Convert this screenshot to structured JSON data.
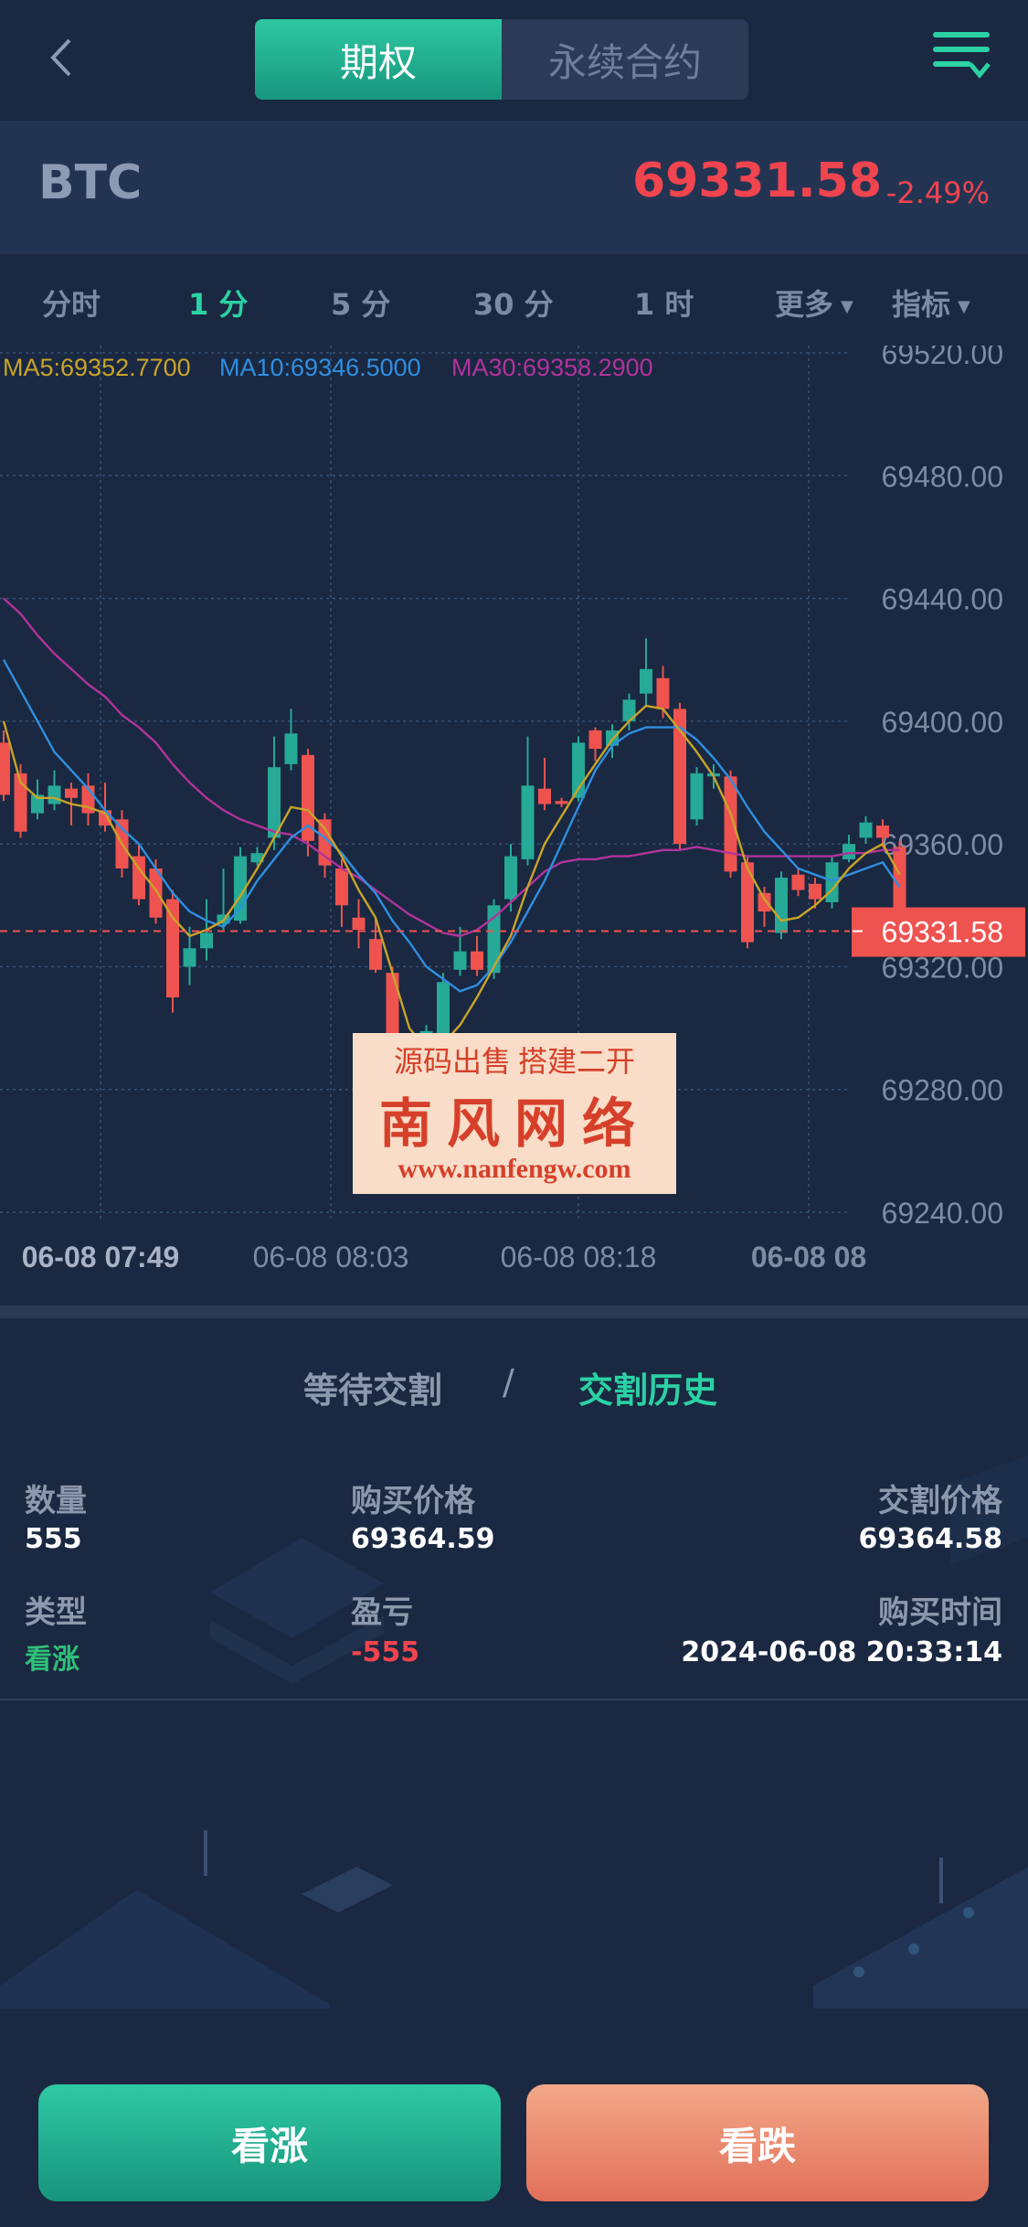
{
  "header": {
    "tabs": [
      {
        "label": "期权",
        "active": true
      },
      {
        "label": "永续合约",
        "active": false
      }
    ],
    "back_icon": "chevron-left-icon",
    "menu_icon": "filter-menu-icon"
  },
  "ticker": {
    "symbol": "BTC",
    "price": "69331.58",
    "change": "-2.49%"
  },
  "timeframes": {
    "items": [
      "分时",
      "1 分",
      "5 分",
      "30 分",
      "1 时",
      "更多",
      "指标"
    ],
    "active": "1 分"
  },
  "chart_data": {
    "type": "candlestick",
    "ma_legend": [
      {
        "label": "MA5:69352.7700",
        "color": "#c9a42a"
      },
      {
        "label": "MA10:69346.5000",
        "color": "#2f8fe0"
      },
      {
        "label": "MA30:69358.2900",
        "color": "#b1339b"
      }
    ],
    "y_ticks": [
      "69520.00",
      "69480.00",
      "69440.00",
      "69400.00",
      "69360.00",
      "69320.00",
      "69280.00",
      "69240.00"
    ],
    "x_ticks": [
      "06-08 07:49",
      "06-08 08:03",
      "06-08 08:18",
      "06-08 08"
    ],
    "last_price_label": "69331.58",
    "ylim": [
      69240,
      69520
    ],
    "candles": [
      [
        69393,
        69376,
        69397,
        69374
      ],
      [
        69383,
        69364,
        69386,
        69362
      ],
      [
        69370,
        69376,
        69381,
        69368
      ],
      [
        69373,
        69379,
        69384,
        69371
      ],
      [
        69378,
        69375,
        69380,
        69366
      ],
      [
        69379,
        69370,
        69383,
        69366
      ],
      [
        69371,
        69366,
        69380,
        69364
      ],
      [
        69368,
        69352,
        69371,
        69349
      ],
      [
        69356,
        69342,
        69360,
        69340
      ],
      [
        69352,
        69336,
        69355,
        69334
      ],
      [
        69342,
        69310,
        69345,
        69305
      ],
      [
        69320,
        69326,
        69333,
        69314
      ],
      [
        69326,
        69331,
        69342,
        69322
      ],
      [
        69334,
        69337,
        69352,
        69332
      ],
      [
        69335,
        69356,
        69359,
        69334
      ],
      [
        69354,
        69357,
        69359,
        69353
      ],
      [
        69362,
        69385,
        69395,
        69358
      ],
      [
        69386,
        69396,
        69404,
        69384
      ],
      [
        69389,
        69361,
        69391,
        69356
      ],
      [
        69368,
        69353,
        69370,
        69349
      ],
      [
        69352,
        69340,
        69355,
        69333
      ],
      [
        69336,
        69332,
        69342,
        69326
      ],
      [
        69329,
        69319,
        69336,
        69318
      ],
      [
        69318,
        69291,
        69320,
        69290
      ],
      [
        69287,
        69283,
        69290,
        69280
      ],
      [
        69288,
        69299,
        69301,
        69286
      ],
      [
        69298,
        69315,
        69318,
        69296
      ],
      [
        69319,
        69325,
        69333,
        69317
      ],
      [
        69325,
        69319,
        69330,
        69317
      ],
      [
        69318,
        69340,
        69342,
        69316
      ],
      [
        69342,
        69356,
        69360,
        69338
      ],
      [
        69355,
        69379,
        69395,
        69353
      ],
      [
        69378,
        69373,
        69388,
        69371
      ],
      [
        69374,
        69373,
        69375,
        69372
      ],
      [
        69375,
        69393,
        69395,
        69374
      ],
      [
        69397,
        69391,
        69398,
        69387
      ],
      [
        69392,
        69397,
        69399,
        69388
      ],
      [
        69400,
        69407,
        69409,
        69397
      ],
      [
        69409,
        69417,
        69427,
        69405
      ],
      [
        69414,
        69404,
        69418,
        69401
      ],
      [
        69404,
        69360,
        69406,
        69358
      ],
      [
        69368,
        69383,
        69385,
        69366
      ],
      [
        69382,
        69383,
        69386,
        69378
      ],
      [
        69382,
        69351,
        69384,
        69349
      ],
      [
        69354,
        69328,
        69356,
        69326
      ],
      [
        69344,
        69338,
        69346,
        69333
      ],
      [
        69331,
        69349,
        69351,
        69329
      ],
      [
        69350,
        69345,
        69352,
        69343
      ],
      [
        69347,
        69342,
        69349,
        69339
      ],
      [
        69341,
        69354,
        69356,
        69339
      ],
      [
        69355,
        69360,
        69363,
        69354
      ],
      [
        69362,
        69367,
        69369,
        69360
      ],
      [
        69366,
        69362,
        69368,
        69359
      ],
      [
        69359,
        69331,
        69361,
        69329
      ]
    ],
    "ma5": [
      69400,
      69380,
      69375,
      69375,
      69373,
      69372,
      69370,
      69360,
      69352,
      69345,
      69336,
      69330,
      69332,
      69335,
      69343,
      69352,
      69362,
      69372,
      69371,
      69365,
      69356,
      69345,
      69336,
      69318,
      69300,
      69293,
      69295,
      69301,
      69310,
      69320,
      69330,
      69346,
      69360,
      69369,
      69378,
      69386,
      69394,
      69400,
      69405,
      69404,
      69397,
      69390,
      69382,
      69370,
      69352,
      69342,
      69335,
      69336,
      69340,
      69345,
      69352,
      69357,
      69360,
      69350
    ],
    "ma10": [
      69420,
      69410,
      69400,
      69390,
      69384,
      69378,
      69371,
      69365,
      69360,
      69352,
      69344,
      69338,
      69335,
      69333,
      69339,
      69348,
      69355,
      69362,
      69366,
      69362,
      69357,
      69350,
      69344,
      69335,
      69328,
      69320,
      69316,
      69312,
      69314,
      69320,
      69328,
      69338,
      69348,
      69360,
      69372,
      69384,
      69392,
      69396,
      69398,
      69398,
      69398,
      69394,
      69388,
      69381,
      69372,
      69364,
      69358,
      69352,
      69350,
      69348,
      69350,
      69352,
      69354,
      69346
    ],
    "ma30": [
      69440,
      69435,
      69428,
      69422,
      69417,
      69412,
      69408,
      69402,
      69398,
      69393,
      69386,
      69380,
      69375,
      69371,
      69368,
      69366,
      69364,
      69363,
      69360,
      69356,
      69352,
      69349,
      69345,
      69341,
      69337,
      69334,
      69331,
      69330,
      69332,
      69336,
      69341,
      69346,
      69351,
      69354,
      69355,
      69355,
      69356,
      69356,
      69357,
      69358,
      69358,
      69359,
      69358,
      69357,
      69356,
      69356,
      69356,
      69356,
      69356,
      69356,
      69357,
      69357,
      69358,
      69358
    ]
  },
  "watermark": {
    "line1": "源码出售  搭建二开",
    "line2": "南风网络",
    "line3": "www.nanfengw.com"
  },
  "history": {
    "tabs": [
      {
        "label": "等待交割",
        "active": false
      },
      {
        "label": "/",
        "active": false
      },
      {
        "label": "交割历史",
        "active": true
      }
    ],
    "fields": {
      "qty_label": "数量",
      "qty_value": "555",
      "buy_price_label": "购买价格",
      "buy_price_value": "69364.59",
      "settle_price_label": "交割价格",
      "settle_price_value": "69364.58",
      "type_label": "类型",
      "type_value": "看涨",
      "pnl_label": "盈亏",
      "pnl_value": "-555",
      "buy_time_label": "购买时间",
      "buy_time_value": "2024-06-08 20:33:14"
    }
  },
  "actions": {
    "buy_up": "看涨",
    "buy_down": "看跌"
  },
  "colors": {
    "up": "#26a996",
    "down": "#ef5350",
    "accent": "#2bd1a4",
    "background": "#1a2841"
  }
}
